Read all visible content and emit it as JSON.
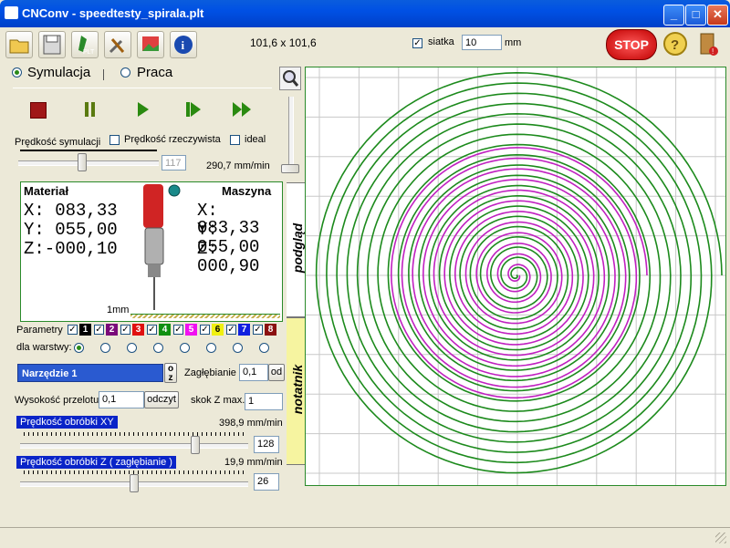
{
  "window": {
    "title": "CNConv - speedtesty_spirala.plt",
    "minimize": "_",
    "maximize": "□",
    "close": "✕"
  },
  "toolbar": {
    "dimensions": "101,6 x 101,6",
    "grid_label": "siatka",
    "grid_checked": true,
    "grid_value": "10",
    "grid_unit": "mm",
    "stop_label": "STOP"
  },
  "mode": {
    "sim_label": "Symulacja",
    "work_label": "Praca",
    "selected": "Symulacja"
  },
  "sim": {
    "speed_label": "Prędkość symulacji",
    "real_speed_label": "Prędkość rzeczywista",
    "ideal_label": "ideal",
    "speed_value": "117",
    "speed_feed": "290,7 mm/min",
    "speed_level": 0.45
  },
  "positions": {
    "material_label": "Materiał",
    "machine_label": "Maszyna",
    "mat_x": "X: 083,33",
    "mat_y": "Y: 055,00",
    "mat_z": "Z:-000,10",
    "mach_x": "X: 083,33",
    "mach_y": "Y: 055,00",
    "mach_z": "Z: 000,90",
    "scale_label": "1mm"
  },
  "tabs": {
    "preview": "podgląd",
    "notes": "notatnik"
  },
  "params": {
    "label": "Parametry",
    "layers_label": "dla warstwy:",
    "colors": [
      {
        "num": "1",
        "bg": "#000000",
        "fg": "#ffffff"
      },
      {
        "num": "2",
        "bg": "#7a0a7a",
        "fg": "#ffffff"
      },
      {
        "num": "3",
        "bg": "#e01010",
        "fg": "#ffffff"
      },
      {
        "num": "4",
        "bg": "#109010",
        "fg": "#ffffff"
      },
      {
        "num": "5",
        "bg": "#f010f0",
        "fg": "#ffffff"
      },
      {
        "num": "6",
        "bg": "#f0f010",
        "fg": "#000000"
      },
      {
        "num": "7",
        "bg": "#1020e0",
        "fg": "#ffffff"
      },
      {
        "num": "8",
        "bg": "#8a1010",
        "fg": "#ffffff"
      }
    ]
  },
  "tool": {
    "name": "Narzędzie 1",
    "oz_o": "o",
    "oz_z": "z",
    "depth_label": "Zagłębianie",
    "depth_value": "0,1",
    "depth_btn": "od",
    "height_label": "Wysokość przelotu",
    "height_value": "0,1",
    "height_btn": "odczyt",
    "skok_label": "skok Z max.",
    "skok_value": "1"
  },
  "feed_xy": {
    "label": "Prędkość obróbki XY",
    "value_text": "398,9 mm/min",
    "value": "128",
    "level": 0.78
  },
  "feed_z": {
    "label": "Prędkość obróbki Z  ( zagłębianie )",
    "value_text": "19,9 mm/min",
    "value": "26",
    "level": 0.5
  },
  "colors": {
    "spiral_green": "#1c8a1c",
    "spiral_magenta": "#c020c0",
    "grid": "#c8c8c8",
    "title_blue": "#0050e4"
  }
}
